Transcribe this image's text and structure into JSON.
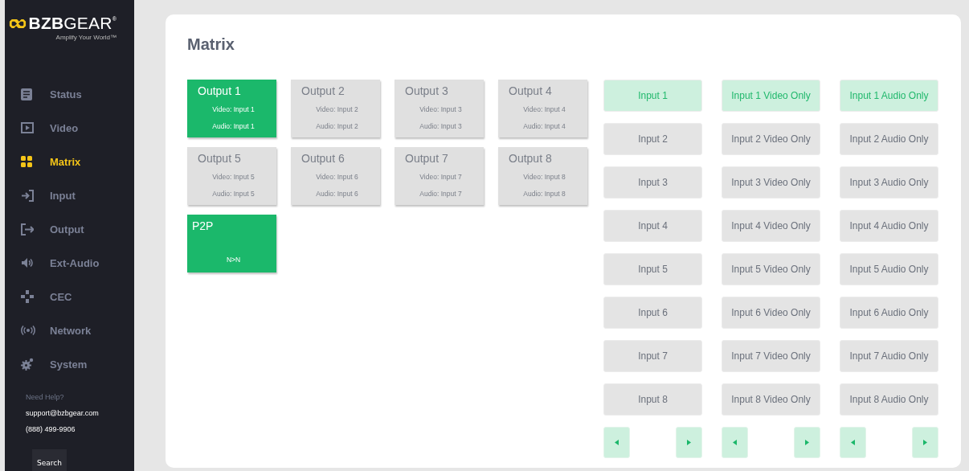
{
  "logo": {
    "brand": "**BZB**GEAR$^{®}$",
    "tagline": "Amplify Your World™"
  },
  "nav": [
    {
      "kind": "status",
      "label": "Status",
      "selected": false
    },
    {
      "kind": "video",
      "label": "Video",
      "selected": false
    },
    {
      "kind": "matrix",
      "label": "Matrix",
      "selected": true
    },
    {
      "kind": "input",
      "label": "Input",
      "selected": false
    },
    {
      "kind": "output",
      "label": "Output",
      "selected": false
    },
    {
      "kind": "audio",
      "label": "Ext-Audio",
      "selected": false
    },
    {
      "kind": "cec",
      "label": "CEC",
      "selected": false
    },
    {
      "kind": "network",
      "label": "Network",
      "selected": false
    },
    {
      "kind": "system",
      "label": "System",
      "selected": false
    }
  ],
  "help": {
    "title": "Need Help?",
    "email": "support@bzbgear.com",
    "phone": "(888) 499-9906"
  },
  "search_button": "Search",
  "page_title": "Matrix",
  "outputs": [
    {
      "kind": "output",
      "title": "Output 1",
      "video": "Video: Input 1",
      "audio": "Audio: Input 1",
      "selected": true
    },
    {
      "kind": "output",
      "title": "Output 2",
      "video": "Video: Input 2",
      "audio": "Audio: Input 2",
      "selected": false
    },
    {
      "kind": "output",
      "title": "Output 3",
      "video": "Video: Input 3",
      "audio": "Audio: Input 3",
      "selected": false
    },
    {
      "kind": "output",
      "title": "Output 4",
      "video": "Video: Input 4",
      "audio": "Audio: Input 4",
      "selected": false
    },
    {
      "kind": "output",
      "title": "Output 5",
      "video": "Video: Input 5",
      "audio": "Audio: Input 5",
      "selected": false
    },
    {
      "kind": "output",
      "title": "Output 6",
      "video": "Video: Input 6",
      "audio": "Audio: Input 6",
      "selected": false
    },
    {
      "kind": "output",
      "title": "Output 7",
      "video": "Video: Input 7",
      "audio": "Audio: Input 7",
      "selected": false
    },
    {
      "kind": "output",
      "title": "Output 8",
      "video": "Video: Input 8",
      "audio": "Audio: Input 8",
      "selected": false
    },
    {
      "kind": "p2p",
      "title": "P2P",
      "mode": "N>N",
      "selected": true
    }
  ],
  "input_columns": [
    {
      "items": [
        {
          "label": "Input 1",
          "selected": true
        },
        {
          "label": "Input 2",
          "selected": false
        },
        {
          "label": "Input 3",
          "selected": false
        },
        {
          "label": "Input 4",
          "selected": false
        },
        {
          "label": "Input 5",
          "selected": false
        },
        {
          "label": "Input 6",
          "selected": false
        },
        {
          "label": "Input 7",
          "selected": false
        },
        {
          "label": "Input 8",
          "selected": false
        }
      ]
    },
    {
      "items": [
        {
          "label": "Input 1 Video Only",
          "selected": true
        },
        {
          "label": "Input 2 Video Only",
          "selected": false
        },
        {
          "label": "Input 3 Video Only",
          "selected": false
        },
        {
          "label": "Input 4 Video Only",
          "selected": false
        },
        {
          "label": "Input 5 Video Only",
          "selected": false
        },
        {
          "label": "Input 6 Video Only",
          "selected": false
        },
        {
          "label": "Input 7 Video Only",
          "selected": false
        },
        {
          "label": "Input 8 Video Only",
          "selected": false
        }
      ]
    },
    {
      "items": [
        {
          "label": "Input 1 Audio Only",
          "selected": true
        },
        {
          "label": "Input 2 Audio Only",
          "selected": false
        },
        {
          "label": "Input 3 Audio Only",
          "selected": false
        },
        {
          "label": "Input 4 Audio Only",
          "selected": false
        },
        {
          "label": "Input 5 Audio Only",
          "selected": false
        },
        {
          "label": "Input 6 Audio Only",
          "selected": false
        },
        {
          "label": "Input 7 Audio Only",
          "selected": false
        },
        {
          "label": "Input 8 Audio Only",
          "selected": false
        }
      ]
    }
  ]
}
